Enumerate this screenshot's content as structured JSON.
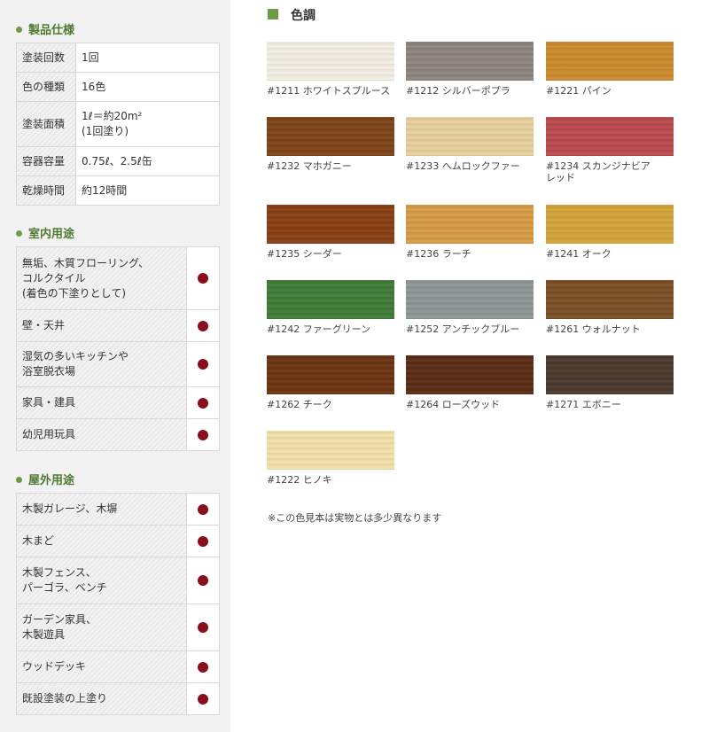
{
  "spec": {
    "title": "製品仕様",
    "rows": [
      {
        "key": "塗装回数",
        "val": "1回"
      },
      {
        "key": "色の種類",
        "val": "16色"
      },
      {
        "key": "塗装面積",
        "val": "1ℓ＝約20m²",
        "val2": "(1回塗り)"
      },
      {
        "key": "容器容量",
        "val": "0.75ℓ、2.5ℓ缶"
      },
      {
        "key": "乾燥時間",
        "val": "約12時間"
      }
    ]
  },
  "indoor": {
    "title": "室内用途",
    "rows": [
      {
        "l1": "無垢、木質フローリング、",
        "l2": "コルクタイル",
        "l3": "(着色の下塗りとして)"
      },
      {
        "l1": "壁・天井"
      },
      {
        "l1": "湿気の多いキッチンや",
        "l2": "浴室脱衣場"
      },
      {
        "l1": "家具・建具"
      },
      {
        "l1": "幼児用玩具"
      }
    ]
  },
  "outdoor": {
    "title": "屋外用途",
    "rows": [
      {
        "l1": "木製ガレージ、木塀"
      },
      {
        "l1": "木まど"
      },
      {
        "l1": "木製フェンス、",
        "l2": "パーゴラ、ベンチ"
      },
      {
        "l1": "ガーデン家具、",
        "l2": "木製遊具"
      },
      {
        "l1": "ウッドデッキ"
      },
      {
        "l1": "既設塗装の上塗り"
      }
    ]
  },
  "colors": {
    "title": "色調",
    "swatches": [
      {
        "label": "#1211 ホワイトスプルース",
        "color": "#f1ede2"
      },
      {
        "label": "#1212 シルバーポプラ",
        "color": "#8c857e"
      },
      {
        "label": "#1221 パイン",
        "color": "#c98a2c"
      },
      {
        "label": "#1232 マホガニー",
        "color": "#7e4418"
      },
      {
        "label": "#1233 ヘムロックファー",
        "color": "#e6cf9d"
      },
      {
        "label": "#1234 スカンジナビア",
        "label2": "レッド",
        "color": "#bb4a4e"
      },
      {
        "label": "#1235 シーダー",
        "color": "#8a3e14"
      },
      {
        "label": "#1236 ラーチ",
        "color": "#d49a46"
      },
      {
        "label": "#1241 オーク",
        "color": "#d2a33a"
      },
      {
        "label": "#1242 ファーグリーン",
        "color": "#3f7c37"
      },
      {
        "label": "#1252 アンチックブルー",
        "color": "#8d9695"
      },
      {
        "label": "#1261 ウォルナット",
        "color": "#7a4f25"
      },
      {
        "label": "#1262 チーク",
        "color": "#6b3410"
      },
      {
        "label": "#1264 ローズウッド",
        "color": "#5b2c16"
      },
      {
        "label": "#1271 エボニー",
        "color": "#4b3a2e"
      },
      {
        "label": "#1222 ヒノキ",
        "color": "#f1e0a9"
      }
    ],
    "note": "※この色見本は実物とは多少異なります"
  },
  "accent": "#6e9a48",
  "mark_color": "#8a0f1c"
}
